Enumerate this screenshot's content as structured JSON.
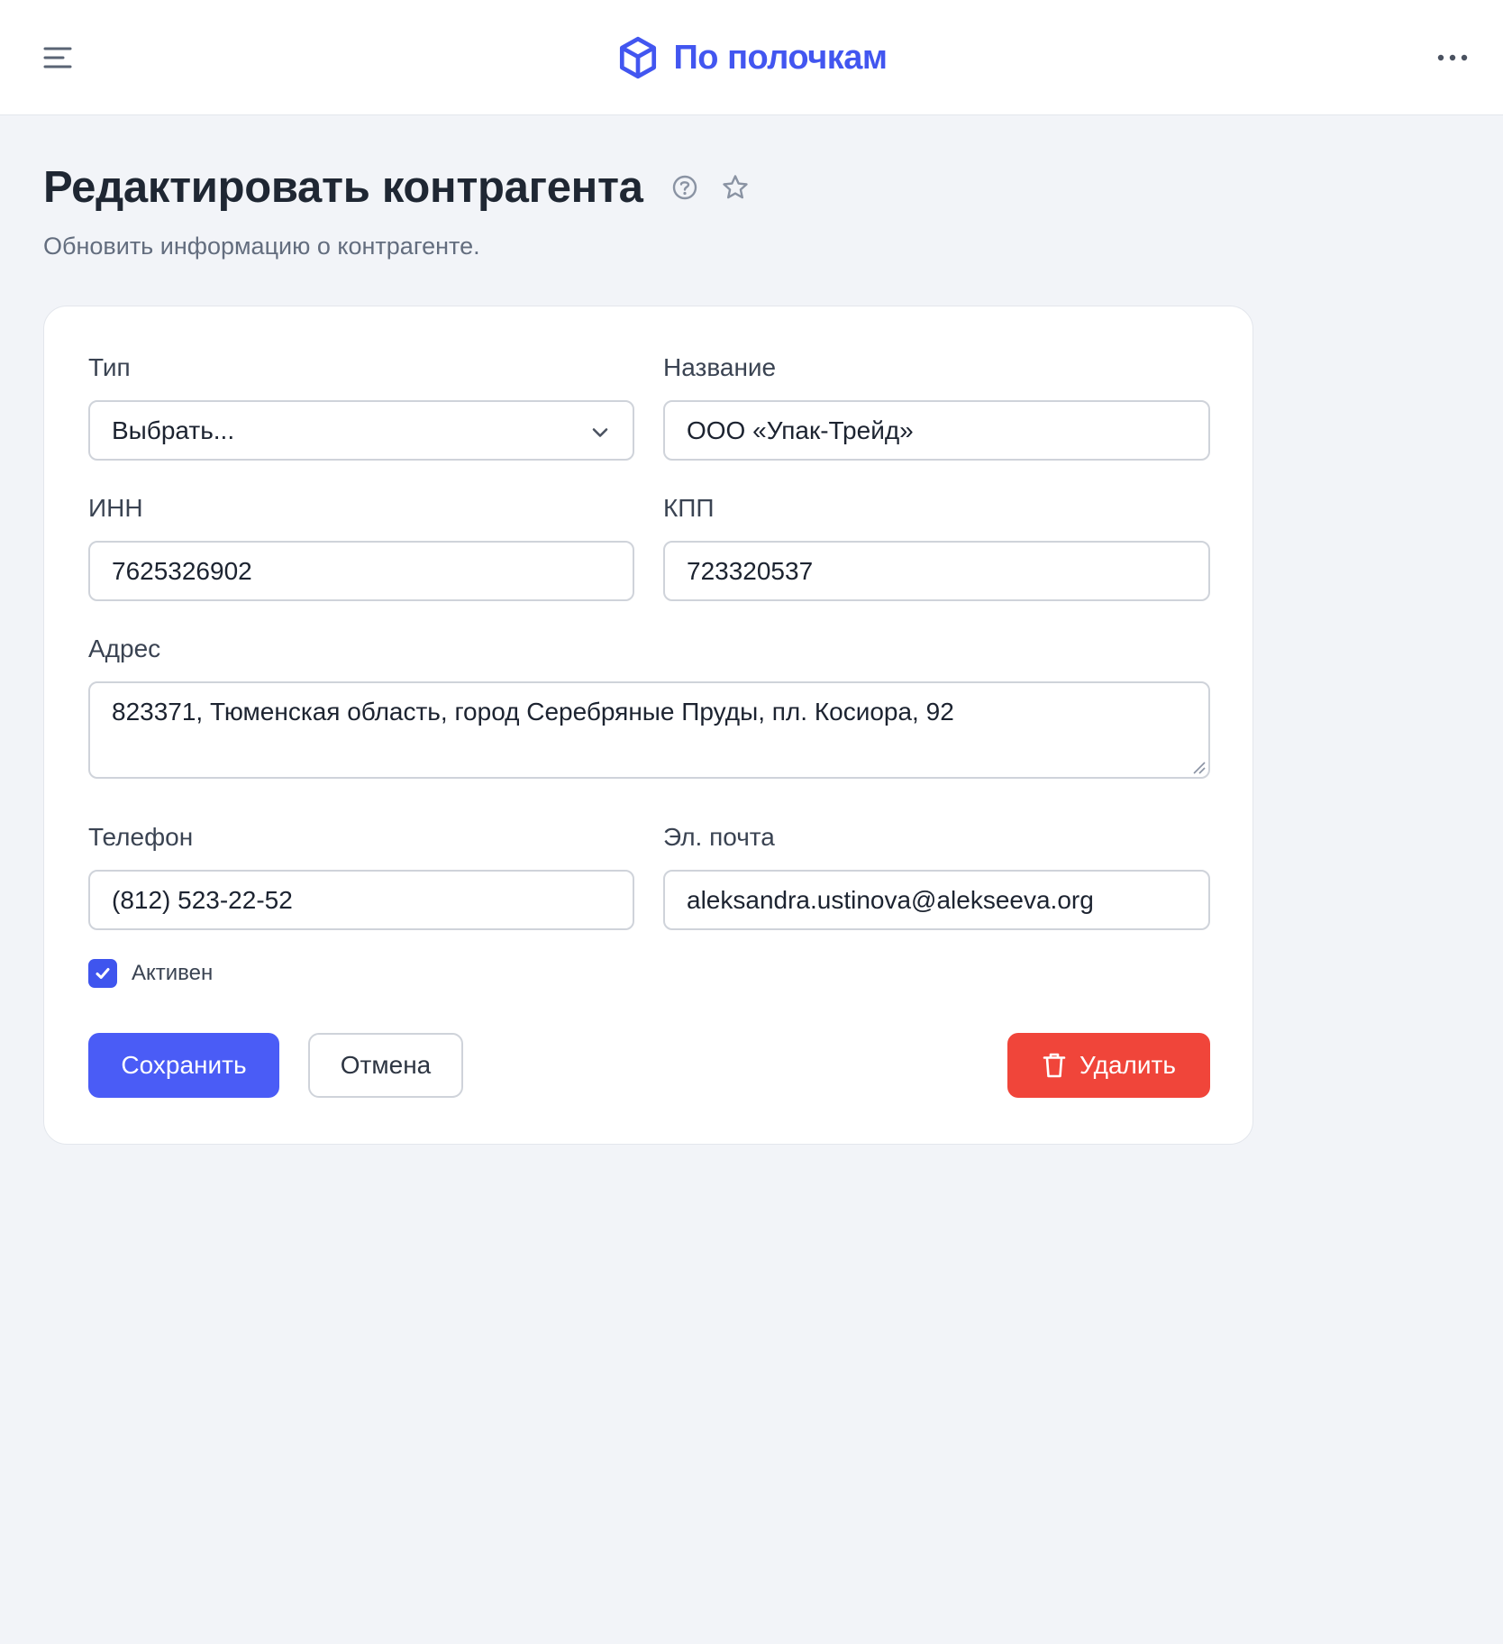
{
  "app": {
    "brand_name": "По полочкам"
  },
  "header": {
    "menu_icon": "menu-icon",
    "logo_icon": "box-icon",
    "more_icon": "more-horizontal-icon"
  },
  "page": {
    "title": "Редактировать контрагента",
    "subtitle": "Обновить информацию о контрагенте.",
    "help_icon": "help-circle-icon",
    "favorite_icon": "star-icon"
  },
  "form": {
    "type": {
      "label": "Тип",
      "selected": "Выбрать..."
    },
    "name": {
      "label": "Название",
      "value": "ООО «Упак-Трейд»"
    },
    "inn": {
      "label": "ИНН",
      "value": "7625326902"
    },
    "kpp": {
      "label": "КПП",
      "value": "723320537"
    },
    "address": {
      "label": "Адрес",
      "value": "823371, Тюменская область, город Серебряные Пруды, пл. Косиора, 92"
    },
    "phone": {
      "label": "Телефон",
      "value": "(812) 523-22-52"
    },
    "email": {
      "label": "Эл. почта",
      "value": "aleksandra.ustinova@alekseeva.org"
    },
    "active": {
      "label": "Активен",
      "checked": true
    }
  },
  "actions": {
    "save_label": "Сохранить",
    "cancel_label": "Отмена",
    "delete_label": "Удалить",
    "delete_icon": "trash-icon"
  },
  "colors": {
    "accent": "#4a5cf6",
    "danger": "#f0453a",
    "background": "#f2f4f8"
  }
}
